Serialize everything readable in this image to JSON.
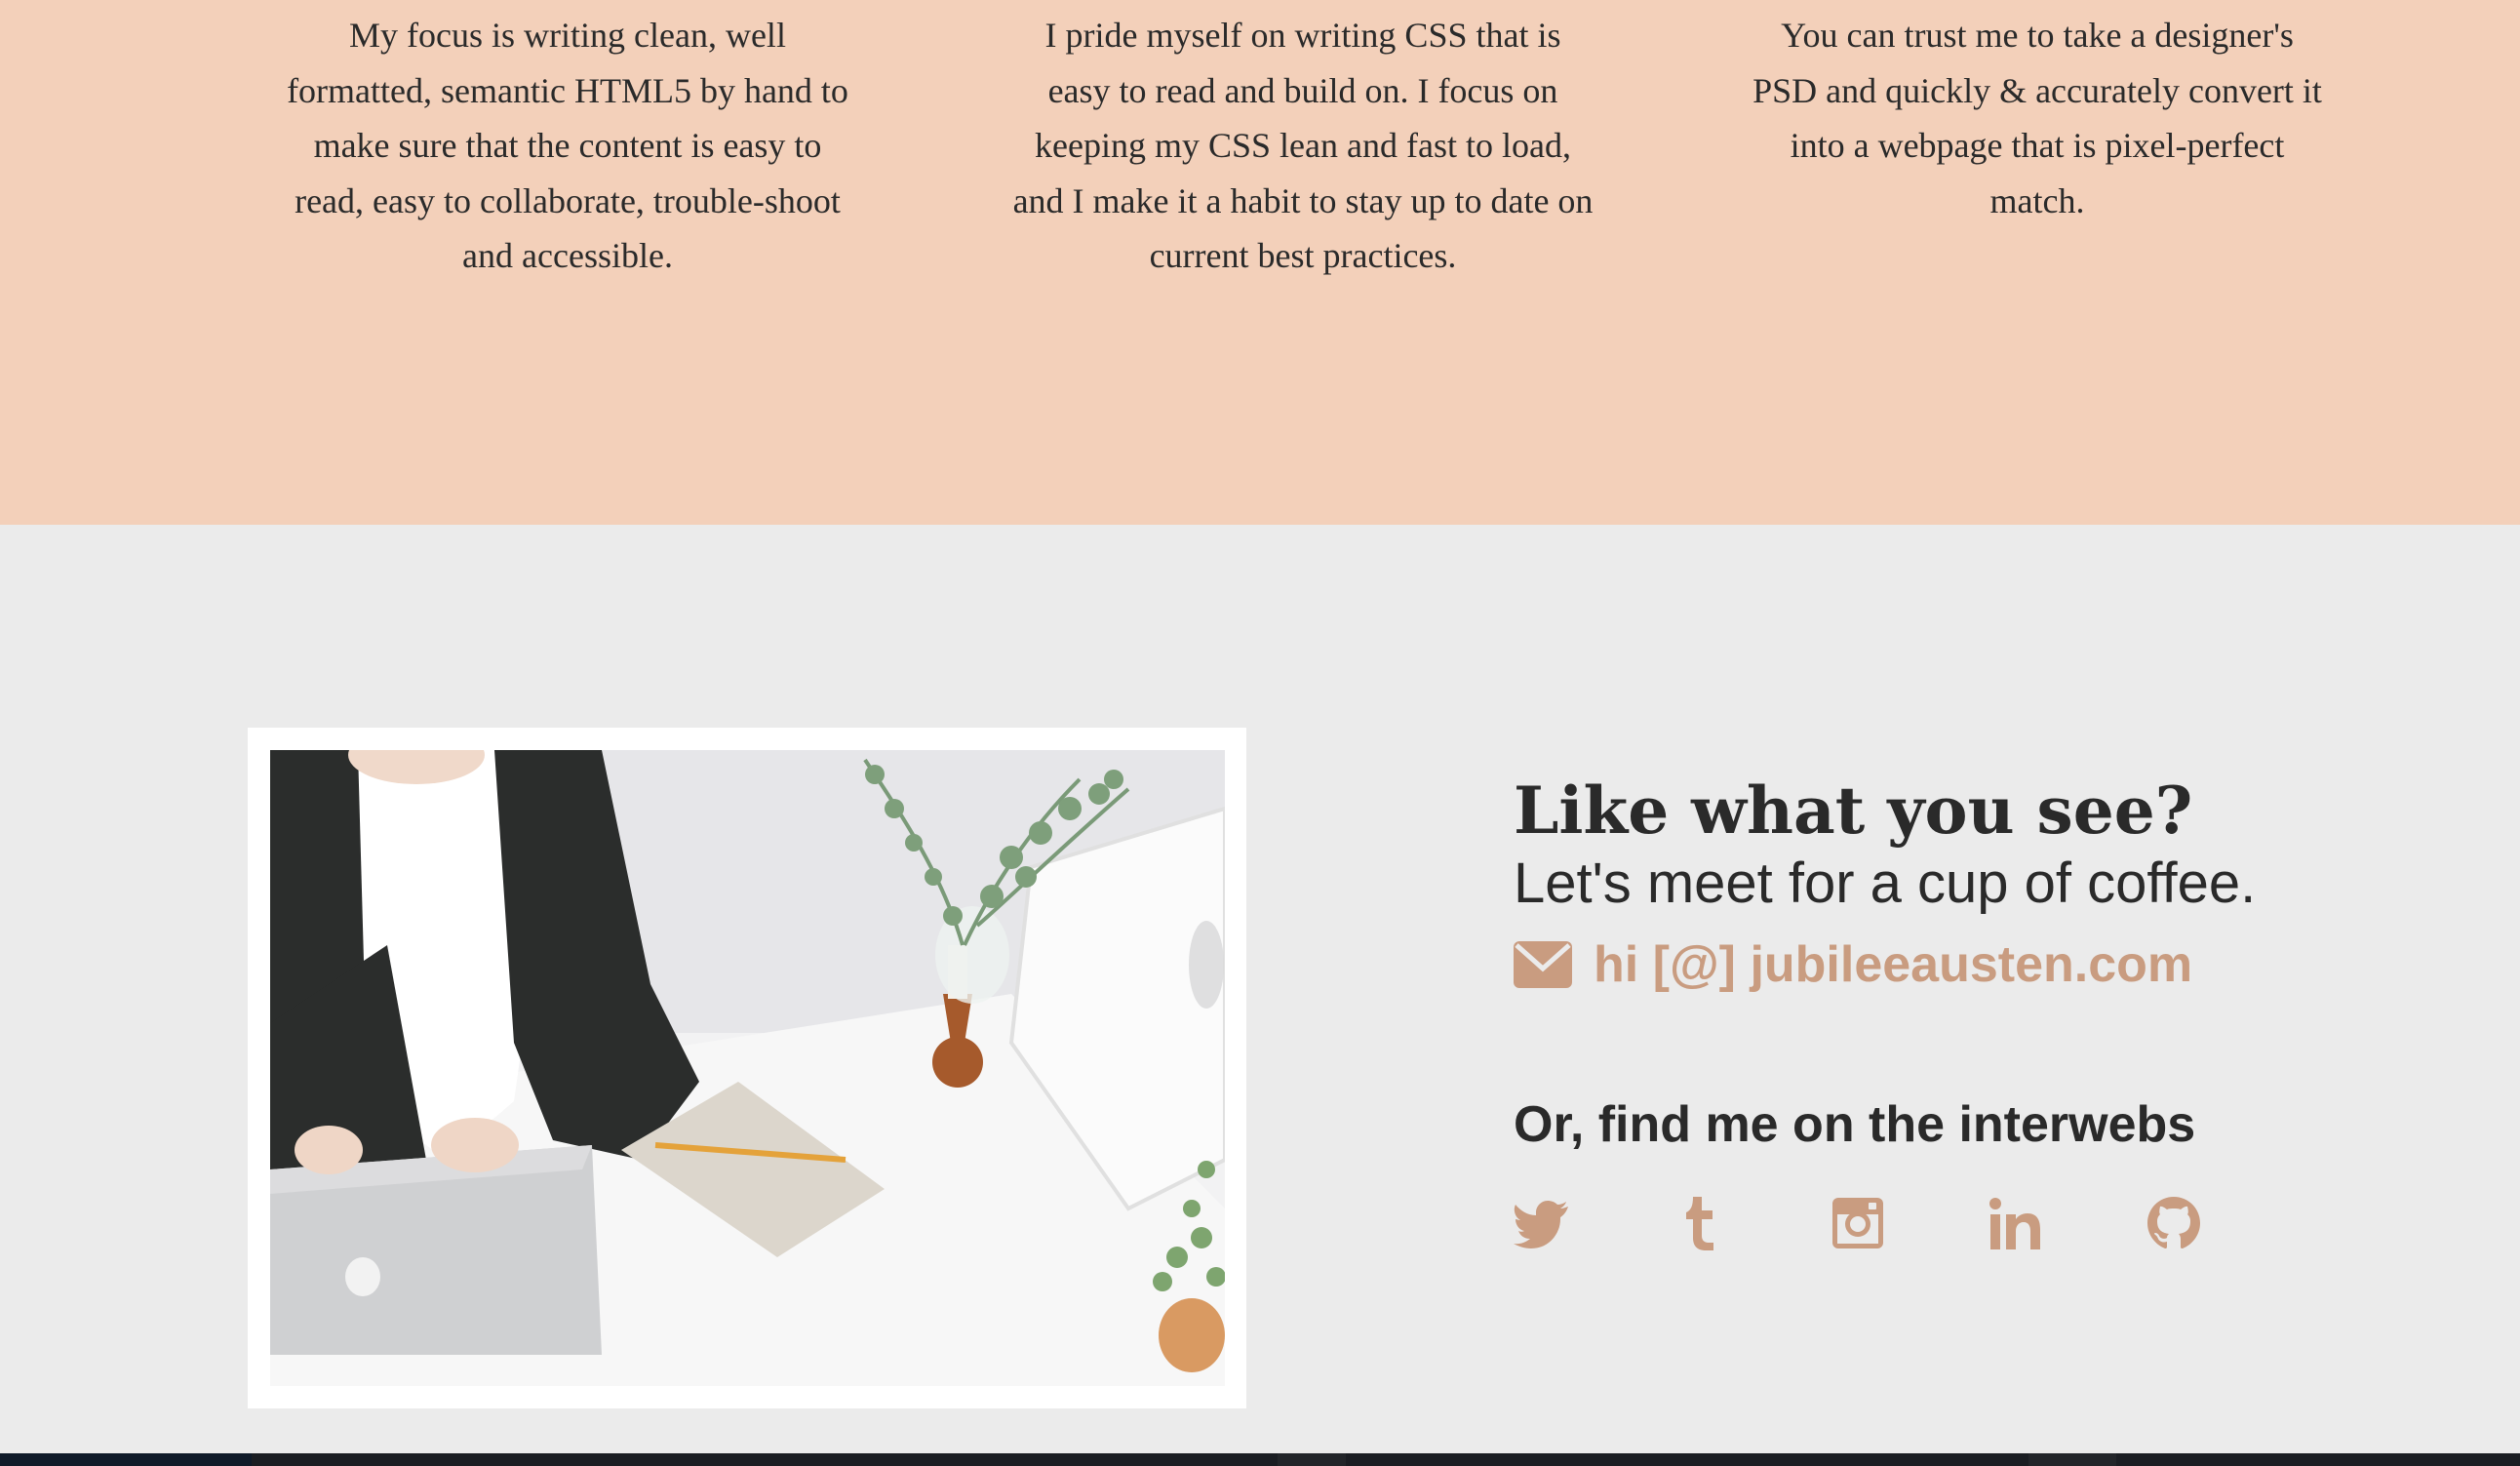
{
  "features": {
    "col1": "My focus is writing clean, well formatted, semantic HTML5 by hand to make sure that the content is easy to read, easy to collaborate, trouble-shoot and accessible.",
    "col2": "I pride myself on writing CSS that is easy to read and build on. I focus on keeping my CSS lean and fast to load, and I make it a habit to stay up to date on current best practices.",
    "col3": "You can trust me to take a designer's PSD and quickly & accurately convert it into a webpage that is pixel-perfect match."
  },
  "contact": {
    "title": "Like what you see?",
    "subtitle": "Let's meet for a cup of coffee.",
    "email": "hi [@] jubileeausten.com",
    "find_title": "Or, find me on the interwebs"
  },
  "social_icons": [
    "twitter-icon",
    "tumblr-icon",
    "instagram-icon",
    "linkedin-icon",
    "github-icon"
  ],
  "colors": {
    "peach_band": "#f3d0ba",
    "light_gray": "#ebebeb",
    "accent": "#c99c80",
    "text": "#2a2a2a"
  }
}
